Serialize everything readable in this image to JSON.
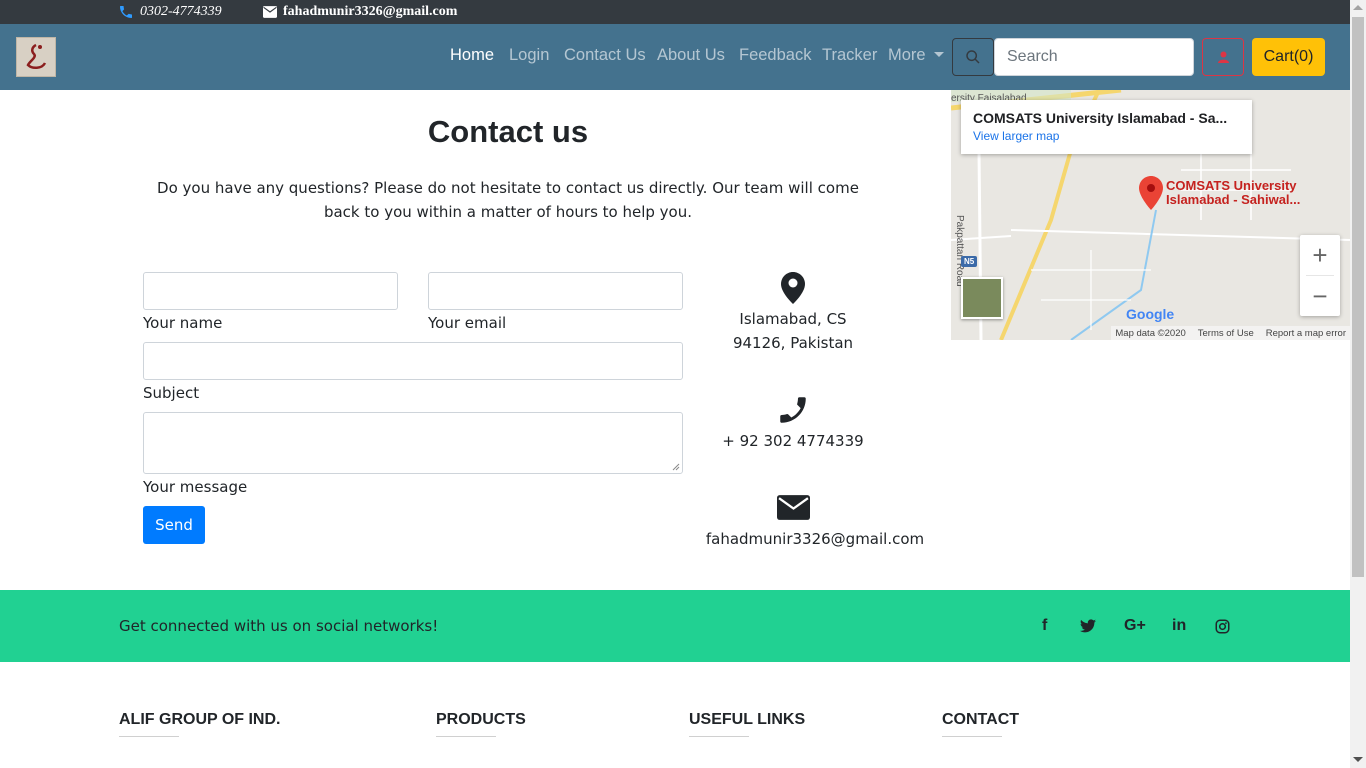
{
  "topbar": {
    "phone": "0302-4774339",
    "email": "fahadmunir3326@gmail.com"
  },
  "nav": {
    "links": [
      "Home",
      "Login",
      "Contact Us",
      "About Us",
      "Feedback",
      "Tracker",
      "More"
    ],
    "search_placeholder": "Search",
    "cart_label": "Cart(0)"
  },
  "contact": {
    "title": "Contact us",
    "intro": "Do you have any questions? Please do not hesitate to contact us directly. Our team will come back to you within a matter of hours to help you.",
    "labels": {
      "name": "Your name",
      "email": "Your email",
      "subject": "Subject",
      "message": "Your message"
    },
    "send_label": "Send",
    "address": "Islamabad, CS 94126, Pakistan",
    "phone": "+ 92 302 4774339",
    "email": "fahadmunir3326@gmail.com"
  },
  "map": {
    "place_title": "COMSATS University Islamabad - Sa...",
    "larger_map_link": "View larger map",
    "pin_label": "COMSATS University Islamabad -  Sahiwal...",
    "road_name": "Pakpattan Road",
    "top_label": "ersity Faisalabad",
    "route_badge": "N5",
    "brand": "Google",
    "map_data": "Map data ©2020",
    "terms": "Terms of Use",
    "report": "Report a map error"
  },
  "social": {
    "message": "Get connected with us on social networks!",
    "icons": [
      "facebook-icon",
      "twitter-icon",
      "google-plus-icon",
      "linkedin-icon",
      "instagram-icon"
    ]
  },
  "footer": {
    "headings": [
      "ALIF GROUP OF IND.",
      "PRODUCTS",
      "USEFUL LINKS",
      "CONTACT"
    ]
  },
  "colors": {
    "navbar": "#44728e",
    "social": "#21d192",
    "send": "#007bff",
    "cart": "#ffc107",
    "topbar": "#343a40"
  }
}
